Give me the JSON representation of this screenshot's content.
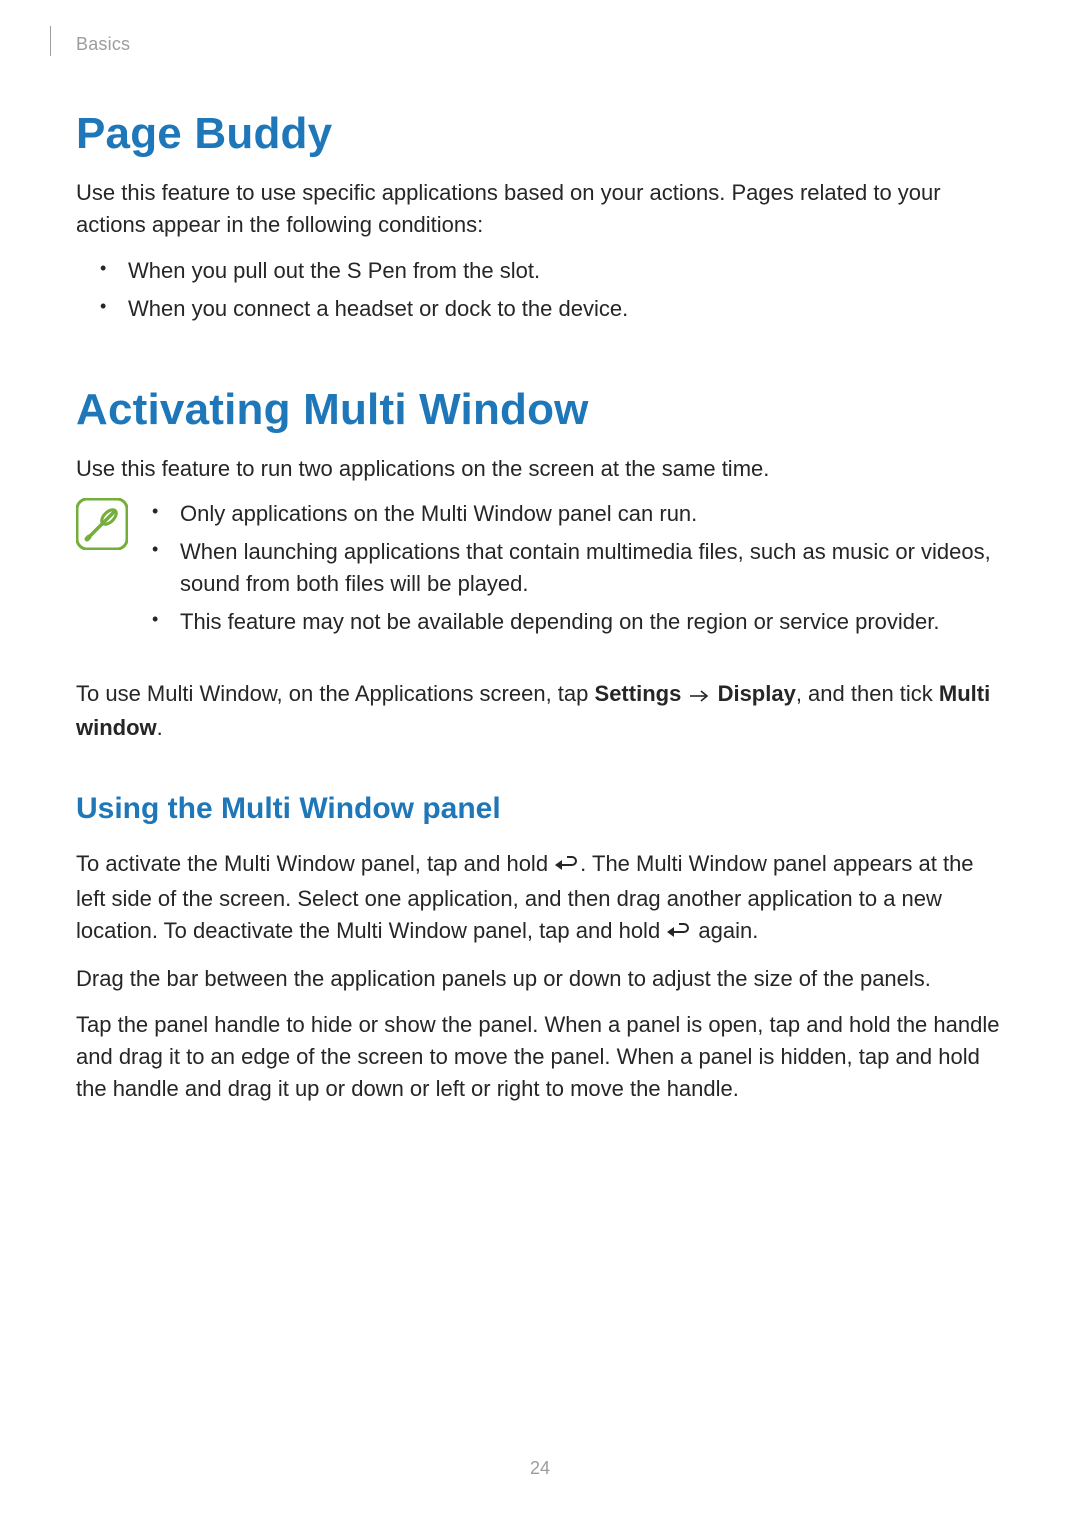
{
  "breadcrumb": "Basics",
  "page_number": "24",
  "sections": {
    "page_buddy": {
      "title": "Page Buddy",
      "intro": "Use this feature to use specific applications based on your actions. Pages related to your actions appear in the following conditions:",
      "bullets": [
        "When you pull out the S Pen from the slot.",
        "When you connect a headset or dock to the device."
      ]
    },
    "multi_window": {
      "title": "Activating Multi Window",
      "intro": "Use this feature to run two applications on the screen at the same time.",
      "notes": [
        "Only applications on the Multi Window panel can run.",
        "When launching applications that contain multimedia files, such as music or videos, sound from both files will be played.",
        "This feature may not be available depending on the region or service provider."
      ],
      "howto_prefix": "To use Multi Window, on the Applications screen, tap ",
      "howto_settings": "Settings",
      "howto_display": "Display",
      "howto_mid": ", and then tick ",
      "howto_multiwindow": "Multi window",
      "howto_suffix": "."
    },
    "using_panel": {
      "title": "Using the Multi Window panel",
      "p1a": "To activate the Multi Window panel, tap and hold ",
      "p1b": ". The Multi Window panel appears at the left side of the screen. Select one application, and then drag another application to a new location. To deactivate the Multi Window panel, tap and hold ",
      "p1c": " again.",
      "p2": "Drag the bar between the application panels up or down to adjust the size of the panels.",
      "p3": "Tap the panel handle to hide or show the panel. When a panel is open, tap and hold the handle and drag it to an edge of the screen to move the panel. When a panel is hidden, tap and hold the handle and drag it up or down or left or right to move the handle."
    }
  }
}
